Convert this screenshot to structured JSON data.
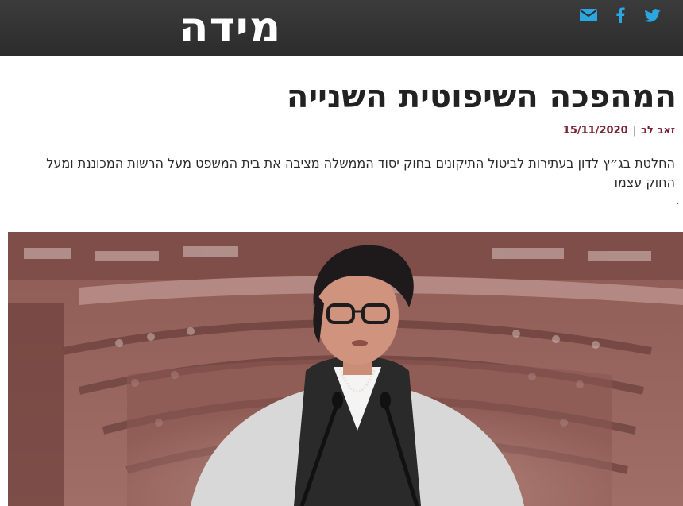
{
  "header": {
    "logo_text": "מידה",
    "background": "#2f2f2f",
    "icons": [
      "mail-icon",
      "facebook-icon",
      "twitter-icon"
    ],
    "icon_color": "#2aa6e0"
  },
  "article": {
    "title": "המהפכה השיפוטית השנייה",
    "author": "זאב לב",
    "date": "15/11/2020",
    "lead": "החלטת בג״ץ לדון בעתירות לביטול התיקונים בחוק יסוד הממשלה מציבה את בית המשפט מעל הרשות המכוננת ומעל החוק עצמו",
    "accent_color": "#7a2233"
  },
  "image": {
    "subject": "portrait-over-parliament-hall"
  }
}
